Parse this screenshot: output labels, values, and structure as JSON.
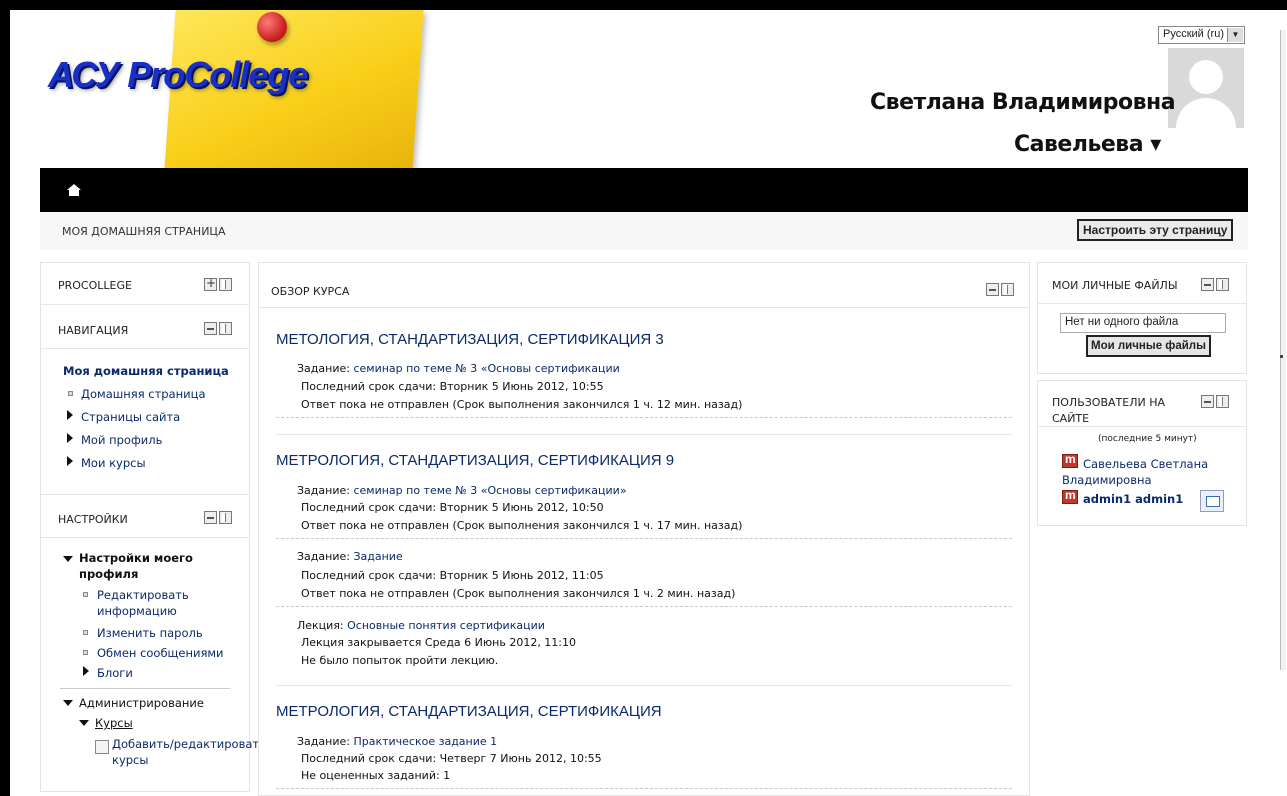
{
  "header": {
    "logo_text": "АСУ ProCollege",
    "language": "Русский (ru)",
    "user_first": "Светлана Владимировна",
    "user_last": "Савельева ▾"
  },
  "breadcrumb": "МОЯ ДОМАШНЯЯ СТРАНИЦА",
  "customize_button": "Настроить эту страницу",
  "left": {
    "procollege_title": "PROCOLLEGE",
    "navigation_title": "НАВИГАЦИЯ",
    "nav_items": [
      "Моя домашняя страница",
      "Домашняя страница",
      "Страницы сайта",
      "Мой профиль",
      "Мои курсы"
    ],
    "settings_title": "НАСТРОЙКИ",
    "settings_profile": [
      "Настройки моего",
      "профиля"
    ],
    "settings_items": [
      [
        "Редактировать",
        "информацию"
      ],
      "Изменить пароль",
      "Обмен сообщениями",
      "Блоги"
    ],
    "admin": "Администрирование",
    "courses": "Курсы",
    "add_edit": [
      "Добавить/редактировать",
      "курсы"
    ]
  },
  "center": {
    "title": "ОБЗОР КУРСА",
    "courses": [
      {
        "name": "МЕТОЛОГИЯ, СТАНДАРТИЗАЦИЯ, СЕРТИФИКАЦИЯ 3",
        "items": [
          {
            "type": "Задание: ",
            "link": "семинар по теме № 3 «Основы сертификации",
            "l2": "Последний срок сдачи: Вторник 5 Июнь 2012, 10:55",
            "l3": "Ответ пока не отправлен (Срок выполнения закончился 1 ч. 12 мин. назад)"
          }
        ]
      },
      {
        "name": "МЕТРОЛОГИЯ, СТАНДАРТИЗАЦИЯ, СЕРТИФИКАЦИЯ 9",
        "items": [
          {
            "type": "Задание: ",
            "link": "семинар по теме № 3 «Основы сертификации»",
            "l2": "Последний срок сдачи: Вторник 5 Июнь 2012, 10:50",
            "l3": "Ответ пока не отправлен (Срок выполнения закончился 1 ч. 17 мин. назад)"
          },
          {
            "type": "Задание: ",
            "link": "Задание",
            "l2": "Последний срок сдачи: Вторник 5 Июнь 2012, 11:05",
            "l3": "Ответ пока не отправлен (Срок выполнения закончился 1 ч. 2 мин. назад)"
          },
          {
            "type": "Лекция: ",
            "link": "Основные понятия сертификации",
            "l2": "Лекция закрывается Среда 6 Июнь 2012, 11:10",
            "l3": "Не было попыток пройти лекцию."
          }
        ]
      },
      {
        "name": "МЕТРОЛОГИЯ, СТАНДАРТИЗАЦИЯ, СЕРТИФИКАЦИЯ",
        "items": [
          {
            "type": "Задание: ",
            "link": "Практическое задание 1",
            "l2": "Последний срок сдачи: Четверг 7 Июнь 2012, 10:55",
            "l3": "Не оцененных заданий: 1"
          }
        ]
      }
    ]
  },
  "right": {
    "files_title": "МОИ ЛИЧНЫЕ ФАЙЛЫ",
    "files_empty": "Нет ни одного файла",
    "files_button": "Мои личные файлы",
    "online_title": [
      "ПОЛЬЗОВАТЕЛИ НА",
      "САЙТЕ"
    ],
    "online_sub": "(последние 5 минут)",
    "users": [
      [
        "Савельева Светлана",
        "Владимировна"
      ],
      "admin1 admin1"
    ]
  }
}
